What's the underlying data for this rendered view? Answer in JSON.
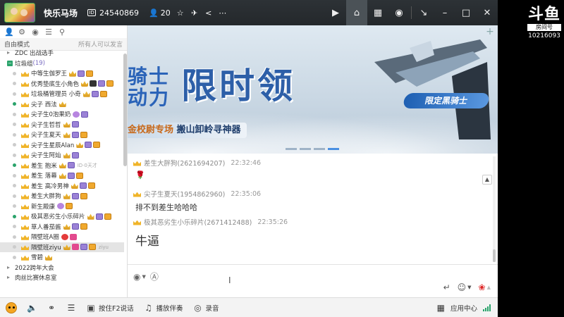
{
  "titlebar": {
    "room_name": "快乐马场",
    "room_id": "24540869",
    "user_count": "20"
  },
  "brand": {
    "logo_text": "斗鱼",
    "sub": "房间号",
    "room_number": "10216093"
  },
  "sidebar": {
    "mode_label": "自由模式",
    "mode_right": "所有人可以发言",
    "items": [
      {
        "type": "group",
        "label": "ZDC 出战选手",
        "icon": "triangle"
      },
      {
        "type": "group",
        "label": "垃圾组",
        "count": "(19)",
        "icon": "square"
      },
      {
        "type": "member",
        "name": "中等生伽罗王",
        "online": false
      },
      {
        "type": "member",
        "name": "优秀垫底生小角色",
        "online": false
      },
      {
        "type": "member",
        "name": "垃圾桶管理员 小奇",
        "online": false
      },
      {
        "type": "member",
        "name": "尖子 西法",
        "online": true
      },
      {
        "type": "member",
        "name": "尖子生0泡果奶",
        "online": false
      },
      {
        "type": "member",
        "name": "尖子生哲哲",
        "online": false
      },
      {
        "type": "member",
        "name": "尖子生夏天",
        "online": false
      },
      {
        "type": "member",
        "name": "尖子生星辰Alan",
        "online": false
      },
      {
        "type": "member",
        "name": "尖子生阿灿",
        "online": false
      },
      {
        "type": "member",
        "name": "差生 抱米",
        "online": true,
        "extra": "ID·0天才"
      },
      {
        "type": "member",
        "name": "差生 落幕",
        "online": false
      },
      {
        "type": "member",
        "name": "差生 高冷男神",
        "online": false
      },
      {
        "type": "member",
        "name": "差生大胖狗",
        "online": false
      },
      {
        "type": "member",
        "name": "新生殿康",
        "online": false
      },
      {
        "type": "member",
        "name": "极其恶劣生小乐碎片",
        "online": true
      },
      {
        "type": "member",
        "name": "草人番茄酱",
        "online": false
      },
      {
        "type": "member",
        "name": "隔壁班A圈",
        "online": false
      },
      {
        "type": "member",
        "name": "隔壁班ziyu",
        "online": false,
        "selected": true,
        "extra": "ziyu"
      },
      {
        "type": "member",
        "name": "雪碧",
        "online": false
      },
      {
        "type": "group",
        "label": "2022跨年大会",
        "icon": "triangle"
      },
      {
        "type": "group",
        "label": "肉丝比赛休息室",
        "icon": "triangle"
      }
    ]
  },
  "banner": {
    "title_left": "骑士",
    "title_left2": "动力",
    "title_main": "限时领",
    "subtitle_a": "金校尉专场",
    "subtitle_b": "搬山卸岭寻神器",
    "tag": "限定黑骑士",
    "active_slide": 4,
    "slide_count": 4
  },
  "chat": {
    "messages": [
      {
        "user": "差生大胖狗(2621694207)",
        "time": "22:32:46",
        "text": "🌹",
        "big": false
      },
      {
        "user": "尖子生夏天(1954862960)",
        "time": "22:35:06",
        "text": "排不到差生哈哈哈",
        "big": false
      },
      {
        "user": "极其恶劣生小乐碎片(2671412488)",
        "time": "22:35:26",
        "text": "牛逼",
        "big": true
      }
    ]
  },
  "bottombar": {
    "ptt_label": "按住F2说话",
    "accompany_label": "播放伴奏",
    "record_label": "录音",
    "app_center_label": "应用中心"
  },
  "colors": {
    "titlebar_bg": "#2d3236",
    "accent_blue": "#2d5fa8",
    "online_green": "#2aa36b",
    "crown_gold": "#f0b429"
  }
}
